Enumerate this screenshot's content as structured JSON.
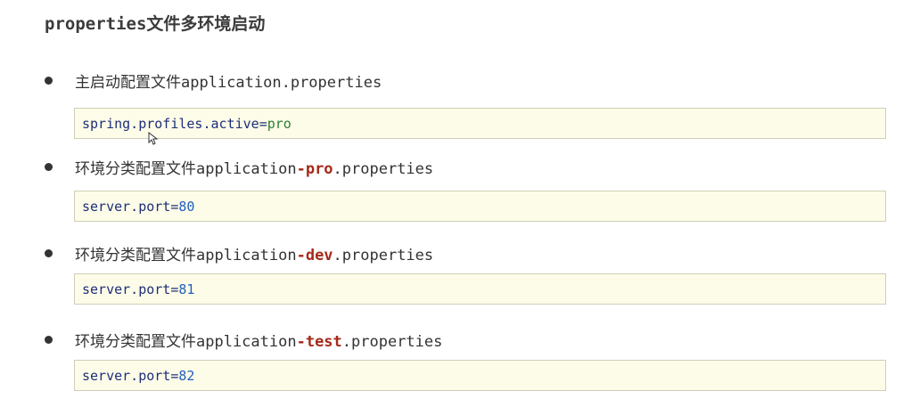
{
  "title": "properties文件多环境启动",
  "items": [
    {
      "prefix": "主启动配置文件application",
      "highlight": "",
      "suffix": ".properties",
      "code": {
        "key": "spring.profiles.active",
        "eq": "=",
        "value": "pro"
      }
    },
    {
      "prefix": "环境分类配置文件application",
      "highlight": "-pro",
      "suffix": ".properties",
      "code": {
        "key": "server.port",
        "eq": "=",
        "value": "80"
      }
    },
    {
      "prefix": "环境分类配置文件application",
      "highlight": "-dev",
      "suffix": ".properties",
      "code": {
        "key": "server.port",
        "eq": "=",
        "value": "81"
      }
    },
    {
      "prefix": "环境分类配置文件application",
      "highlight": "-test",
      "suffix": ".properties",
      "code": {
        "key": "server.port",
        "eq": "=",
        "value": "82"
      }
    }
  ],
  "colors": {
    "highlight": "#a52a1a",
    "code_bg": "#fcfce8",
    "code_key": "#1f2e7a",
    "code_string": "#2e7d32",
    "code_number": "#1f5fbf"
  },
  "icons": {
    "cursor": "mouse-pointer-icon"
  }
}
